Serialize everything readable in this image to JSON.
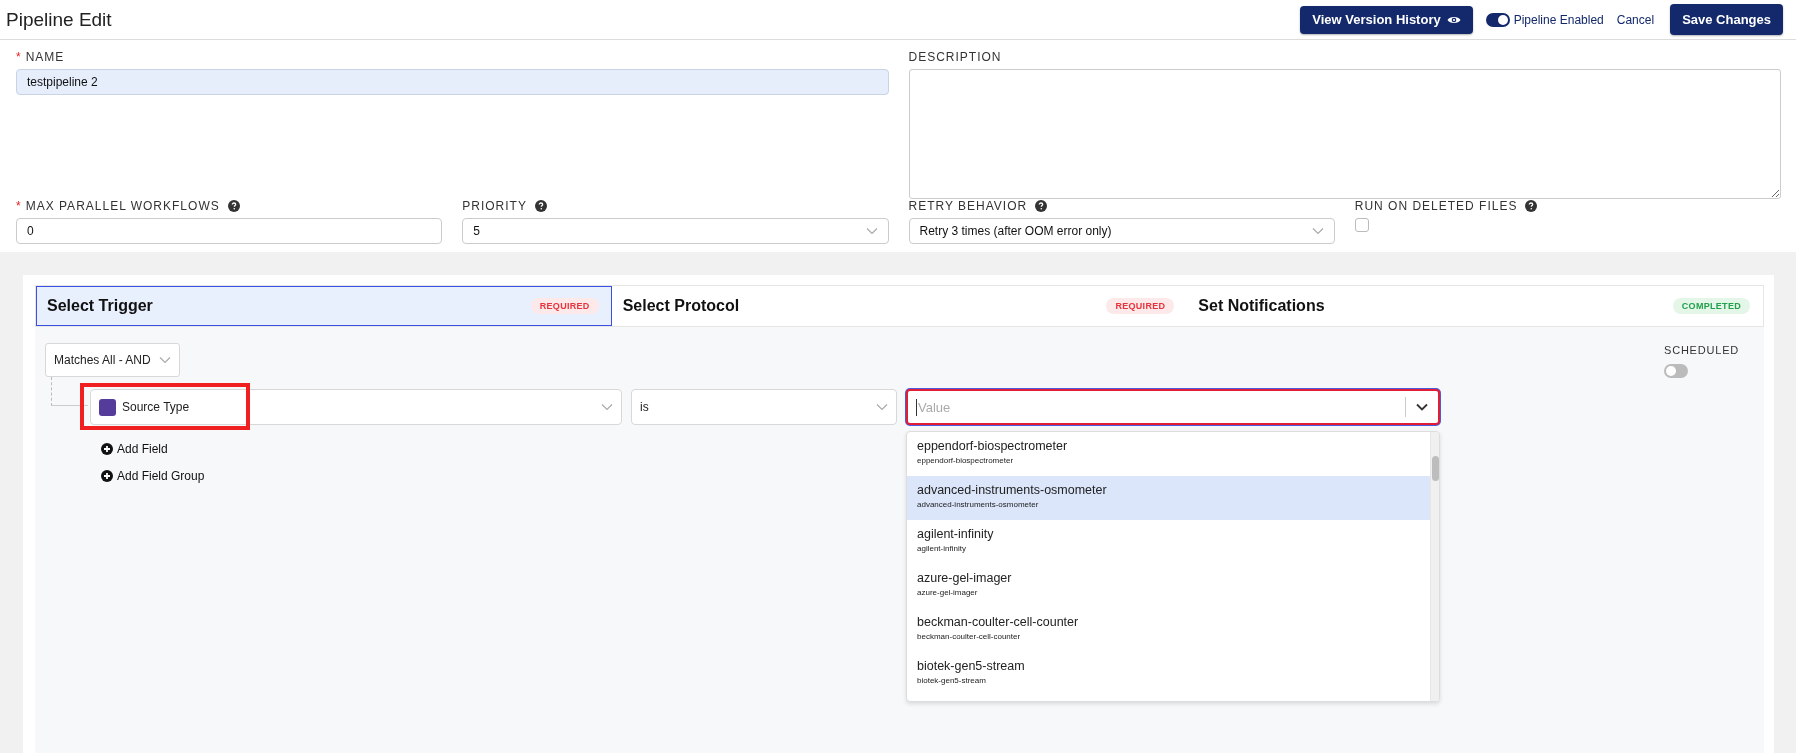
{
  "header": {
    "title": "Pipeline Edit",
    "history_button": "View Version History",
    "enabled_toggle": {
      "label": "Pipeline Enabled",
      "on": true
    },
    "cancel": "Cancel",
    "save": "Save Changes"
  },
  "form": {
    "fields": [
      {
        "kind": "text",
        "label": "NAME",
        "required_mark": "*",
        "help": false,
        "value": "testpipeline 2",
        "filled": true
      },
      {
        "kind": "textarea",
        "label": "DESCRIPTION",
        "help": false
      },
      {
        "kind": "text",
        "label": "MAX PARALLEL WORKFLOWS",
        "required_mark": "*",
        "help": true,
        "value": "0",
        "filled": false
      },
      {
        "kind": "select",
        "label": "PRIORITY",
        "help": true,
        "value": "5"
      },
      {
        "kind": "select",
        "label": "RETRY BEHAVIOR",
        "help": true,
        "value": "Retry 3 times (after OOM error only)"
      },
      {
        "kind": "checkbox",
        "label": "RUN ON DELETED FILES",
        "help": true,
        "checked": false
      }
    ]
  },
  "tabs": [
    {
      "label": "Select Trigger",
      "badge": "REQUIRED",
      "kind": "required",
      "selected": true
    },
    {
      "label": "Select Protocol",
      "badge": "REQUIRED",
      "kind": "required",
      "selected": false
    },
    {
      "label": "Set Notifications",
      "badge": "COMPLETED",
      "kind": "completed",
      "selected": false
    }
  ],
  "filter": {
    "match": "Matches All - AND",
    "condition": {
      "field": "Source Type",
      "operator": "is",
      "value_placeholder": "Value",
      "highlighted": true,
      "expanded": true
    },
    "add_actions": [
      "Add Field",
      "Add Field Group"
    ],
    "scheduled": {
      "label": "SCHEDULED",
      "on": false
    }
  },
  "options": [
    {
      "label": "eppendorf-biospectrometer",
      "sublabel": "eppendorf-biospectrometer",
      "selected": false
    },
    {
      "label": "advanced-instruments-osmometer",
      "sublabel": "advanced-instruments-osmometer",
      "selected": true
    },
    {
      "label": "agilent-infinity",
      "sublabel": "agilent-infinity",
      "selected": false
    },
    {
      "label": "azure-gel-imager",
      "sublabel": "azure-gel-imager",
      "selected": false
    },
    {
      "label": "beckman-coulter-cell-counter",
      "sublabel": "beckman-coulter-cell-counter",
      "selected": false
    },
    {
      "label": "biotek-gen5-stream",
      "sublabel": "biotek-gen5-stream",
      "selected": false
    }
  ]
}
